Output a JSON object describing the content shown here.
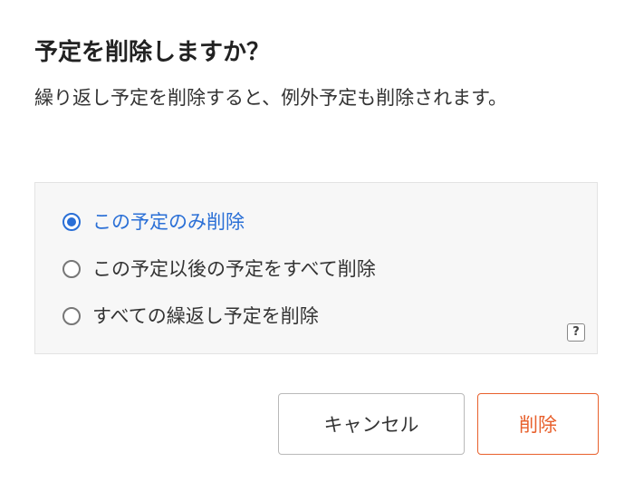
{
  "dialog": {
    "title": "予定を削除しますか？",
    "message": "繰り返し予定を削除すると、例外予定も削除されます。"
  },
  "options": [
    {
      "label": "この予定のみ削除",
      "selected": true
    },
    {
      "label": "この予定以後の予定をすべて削除",
      "selected": false
    },
    {
      "label": "すべての繰返し予定を削除",
      "selected": false
    }
  ],
  "help": {
    "label": "?"
  },
  "buttons": {
    "cancel_label": "キャンセル",
    "delete_label": "削除"
  },
  "colors": {
    "accent": "#2a6fd6",
    "danger": "#e8602c"
  }
}
